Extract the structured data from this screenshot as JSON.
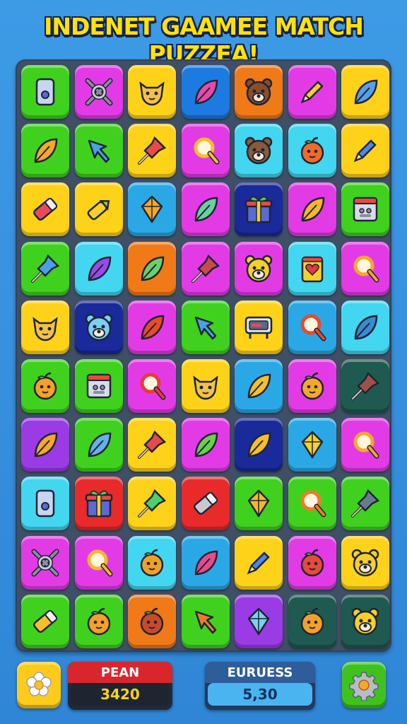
{
  "title": "INDENET GAAMEE MATCH PUZZEA!",
  "grid": {
    "rows": 10,
    "cols": 7,
    "tiles": [
      [
        {
          "bg": "#3fd11e",
          "icon": "card-icon",
          "fg": "#5a6bd6"
        },
        {
          "bg": "#e23be6",
          "icon": "cross-ring-icon",
          "fg": "#8a8ea0"
        },
        {
          "bg": "#ffd21a",
          "icon": "cat-face-icon",
          "fg": "#f5c04a"
        },
        {
          "bg": "#1d7ae0",
          "icon": "leaf-icon",
          "fg": "#e84aa8"
        },
        {
          "bg": "#f07a18",
          "icon": "bear-face-icon",
          "fg": "#8a4e2a"
        },
        {
          "bg": "#e23be6",
          "icon": "pencil-icon",
          "fg": "#f5d02a"
        },
        {
          "bg": "#ffd21a",
          "icon": "leaf-icon",
          "fg": "#5a9ee8"
        }
      ],
      [
        {
          "bg": "#3fd11e",
          "icon": "leaf-icon",
          "fg": "#f5a82a"
        },
        {
          "bg": "#3fd11e",
          "icon": "arrow-icon",
          "fg": "#4aa0e8"
        },
        {
          "bg": "#ffd21a",
          "icon": "pin-icon",
          "fg": "#e84a4a"
        },
        {
          "bg": "#e23be6",
          "icon": "magnifier-icon",
          "fg": "#f5c02a"
        },
        {
          "bg": "#42d6f0",
          "icon": "bear-face-icon",
          "fg": "#8a5a3a"
        },
        {
          "bg": "#42d6f0",
          "icon": "fruit-face-icon",
          "fg": "#f06a2a"
        },
        {
          "bg": "#ffd21a",
          "icon": "pencil-icon",
          "fg": "#4a8ae8"
        }
      ],
      [
        {
          "bg": "#ffd21a",
          "icon": "eraser-icon",
          "fg": "#e84a5a"
        },
        {
          "bg": "#ffd21a",
          "icon": "crayon-icon",
          "fg": "#a0d62a"
        },
        {
          "bg": "#2aa8e6",
          "icon": "kite-icon",
          "fg": "#f5a82a"
        },
        {
          "bg": "#e23be6",
          "icon": "leaf-icon",
          "fg": "#6ad0a0"
        },
        {
          "bg": "#1a2a9a",
          "icon": "gift-icon",
          "fg": "#f5d02a"
        },
        {
          "bg": "#e23be6",
          "icon": "leaf-icon",
          "fg": "#f5b82a"
        },
        {
          "bg": "#3fd11e",
          "icon": "window-icon",
          "fg": "#8a8ea0"
        }
      ],
      [
        {
          "bg": "#3fd11e",
          "icon": "pin-icon",
          "fg": "#4aa0e8"
        },
        {
          "bg": "#42d6f0",
          "icon": "leaf-icon",
          "fg": "#9a4ae8"
        },
        {
          "bg": "#f07a18",
          "icon": "leaf-icon",
          "fg": "#6ad06a"
        },
        {
          "bg": "#e23be6",
          "icon": "pin-icon",
          "fg": "#c84a4a"
        },
        {
          "bg": "#e23be6",
          "icon": "bear-face-icon",
          "fg": "#f5d02a"
        },
        {
          "bg": "#42d6f0",
          "icon": "heart-card-icon",
          "fg": "#f5d02a"
        },
        {
          "bg": "#e23be6",
          "icon": "magnifier-icon",
          "fg": "#f5a82a"
        }
      ],
      [
        {
          "bg": "#ffd21a",
          "icon": "cat-face-icon",
          "fg": "#f5c04a"
        },
        {
          "bg": "#1a2a9a",
          "icon": "bear-face-icon",
          "fg": "#7ad0f0"
        },
        {
          "bg": "#e23be6",
          "icon": "leaf-icon",
          "fg": "#e84a2a"
        },
        {
          "bg": "#3fd11e",
          "icon": "arrow-icon",
          "fg": "#4aa0e8"
        },
        {
          "bg": "#ffd21a",
          "icon": "screen-icon",
          "fg": "#5a6a80"
        },
        {
          "bg": "#2aa8e6",
          "icon": "magnifier-icon",
          "fg": "#e84a2a"
        },
        {
          "bg": "#42d6f0",
          "icon": "leaf-icon",
          "fg": "#3a8ad0"
        }
      ],
      [
        {
          "bg": "#3fd11e",
          "icon": "fruit-face-icon",
          "fg": "#f5a02a"
        },
        {
          "bg": "#3fd11e",
          "icon": "window-icon",
          "fg": "#8a8ea0"
        },
        {
          "bg": "#e23be6",
          "icon": "magnifier-icon",
          "fg": "#e83a3a"
        },
        {
          "bg": "#ffd21a",
          "icon": "cat-face-icon",
          "fg": "#f5c04a"
        },
        {
          "bg": "#2aa8e6",
          "icon": "leaf-icon",
          "fg": "#f5c02a"
        },
        {
          "bg": "#e23be6",
          "icon": "fruit-face-icon",
          "fg": "#f5a82a"
        },
        {
          "bg": "#1e5a50",
          "icon": "pin-icon",
          "fg": "#a0504a"
        }
      ],
      [
        {
          "bg": "#9a3be6",
          "icon": "leaf-icon",
          "fg": "#f5a82a"
        },
        {
          "bg": "#3fd11e",
          "icon": "leaf-icon",
          "fg": "#6ab0e8"
        },
        {
          "bg": "#ffd21a",
          "icon": "pin-icon",
          "fg": "#e84a4a"
        },
        {
          "bg": "#e23be6",
          "icon": "leaf-icon",
          "fg": "#6ad04a"
        },
        {
          "bg": "#1a2a9a",
          "icon": "leaf-icon",
          "fg": "#f5c02a"
        },
        {
          "bg": "#2aa8e6",
          "icon": "kite-icon",
          "fg": "#f5d02a"
        },
        {
          "bg": "#e23be6",
          "icon": "magnifier-icon",
          "fg": "#f5a82a"
        }
      ],
      [
        {
          "bg": "#42d6f0",
          "icon": "card-icon",
          "fg": "#5a6bd6"
        },
        {
          "bg": "#e82a2a",
          "icon": "gift-icon",
          "fg": "#f5d02a"
        },
        {
          "bg": "#ffd21a",
          "icon": "pin-icon",
          "fg": "#4ad06a"
        },
        {
          "bg": "#e82a2a",
          "icon": "eraser-icon",
          "fg": "#c8c8d0"
        },
        {
          "bg": "#3fd11e",
          "icon": "kite-icon",
          "fg": "#f5b82a"
        },
        {
          "bg": "#3fd11e",
          "icon": "magnifier-icon",
          "fg": "#f07a2a"
        },
        {
          "bg": "#3fd11e",
          "icon": "pin-icon",
          "fg": "#6a7a90"
        }
      ],
      [
        {
          "bg": "#e23be6",
          "icon": "cross-ring-icon",
          "fg": "#8a8ea0"
        },
        {
          "bg": "#e23be6",
          "icon": "magnifier-icon",
          "fg": "#f5b82a"
        },
        {
          "bg": "#42d6f0",
          "icon": "fruit-face-icon",
          "fg": "#f0a02a"
        },
        {
          "bg": "#2aa8e6",
          "icon": "leaf-icon",
          "fg": "#e84a8a"
        },
        {
          "bg": "#ffd21a",
          "icon": "pencil-icon",
          "fg": "#4a8ae8"
        },
        {
          "bg": "#e23be6",
          "icon": "fruit-face-icon",
          "fg": "#e84a3a"
        },
        {
          "bg": "#ffd21a",
          "icon": "bear-face-icon",
          "fg": "#f5d02a"
        }
      ],
      [
        {
          "bg": "#3fd11e",
          "icon": "eraser-icon",
          "fg": "#f5c02a"
        },
        {
          "bg": "#3fd11e",
          "icon": "fruit-face-icon",
          "fg": "#f5a02a"
        },
        {
          "bg": "#f07a18",
          "icon": "fruit-face-icon",
          "fg": "#c84a2a"
        },
        {
          "bg": "#3fd11e",
          "icon": "arrow-icon",
          "fg": "#f07a2a"
        },
        {
          "bg": "#9a3be6",
          "icon": "kite-icon",
          "fg": "#7ad0f0"
        },
        {
          "bg": "#1e5a50",
          "icon": "fruit-face-icon",
          "fg": "#f5a02a"
        },
        {
          "bg": "#1e5a50",
          "icon": "bear-face-icon",
          "fg": "#f5d02a"
        }
      ]
    ]
  },
  "hud": {
    "score_label": "PEAN",
    "score_value": "3420",
    "bonus_label": "EURUESS",
    "bonus_value": "5,30",
    "left_button_icon": "flower-icon",
    "right_button_icon": "gear-icon"
  },
  "colors": {
    "background": "#3594df",
    "board": "#3f4f66",
    "title": "#ffe20a",
    "score_header": "#d8262c",
    "bonus_header": "#2f5d9a",
    "bonus_value_bg": "#4ab4f0"
  }
}
